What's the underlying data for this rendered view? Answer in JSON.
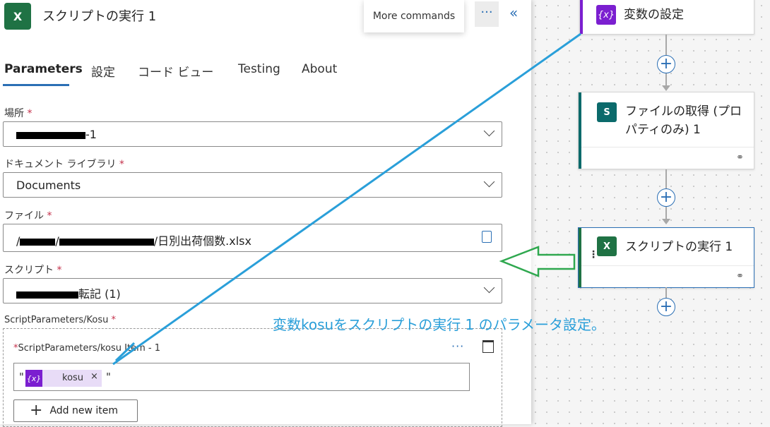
{
  "panel": {
    "title": "スクリプトの実行 1",
    "app_icon_letter": "X",
    "more_commands_tooltip": "More commands",
    "more_button_glyph": "···",
    "collapse_glyph": "«",
    "tabs": [
      {
        "label": "Parameters",
        "active": true
      },
      {
        "label": "設定",
        "active": false
      },
      {
        "label": "コード ビュー",
        "active": false
      },
      {
        "label": "Testing",
        "active": false
      },
      {
        "label": "About",
        "active": false
      }
    ],
    "location": {
      "label": "場所",
      "value_suffix": "-1"
    },
    "library": {
      "label": "ドキュメント ライブラリ",
      "value": "Documents"
    },
    "file": {
      "label": "ファイル",
      "value_prefix": "/",
      "value_mid": "/",
      "value_suffix": "/日別出荷個数.xlsx"
    },
    "script": {
      "label": "スクリプト",
      "value_suffix": "転記 (1)"
    },
    "script_params": {
      "label": "ScriptParameters/Kosu",
      "item_label": "ScriptParameters/kosu Item - 1",
      "token_name": "kosu",
      "token_remove": "×",
      "token_icon": "{x}",
      "quote": "\"",
      "add_item_label": "Add new item",
      "dots": "···"
    },
    "required_mark": "*"
  },
  "flow": {
    "set_variable": {
      "title": "変数の設定",
      "icon": "{x}",
      "color": "#7b1fd0"
    },
    "get_file": {
      "title_line1": "ファイルの取得 (プロ",
      "title_line2": "パティのみ) 1",
      "icon": "S",
      "color": "#0b6a6b"
    },
    "run_script": {
      "title": "スクリプトの実行 1",
      "icon": "X",
      "color": "#1f7244"
    },
    "link_icon": "link-icon"
  },
  "annotation": {
    "note": "変数kosuをスクリプトの実行 1 のパラメータ設定。",
    "blue_line_color": "#2a9fd9",
    "green_arrow_color": "#2fa84f"
  }
}
